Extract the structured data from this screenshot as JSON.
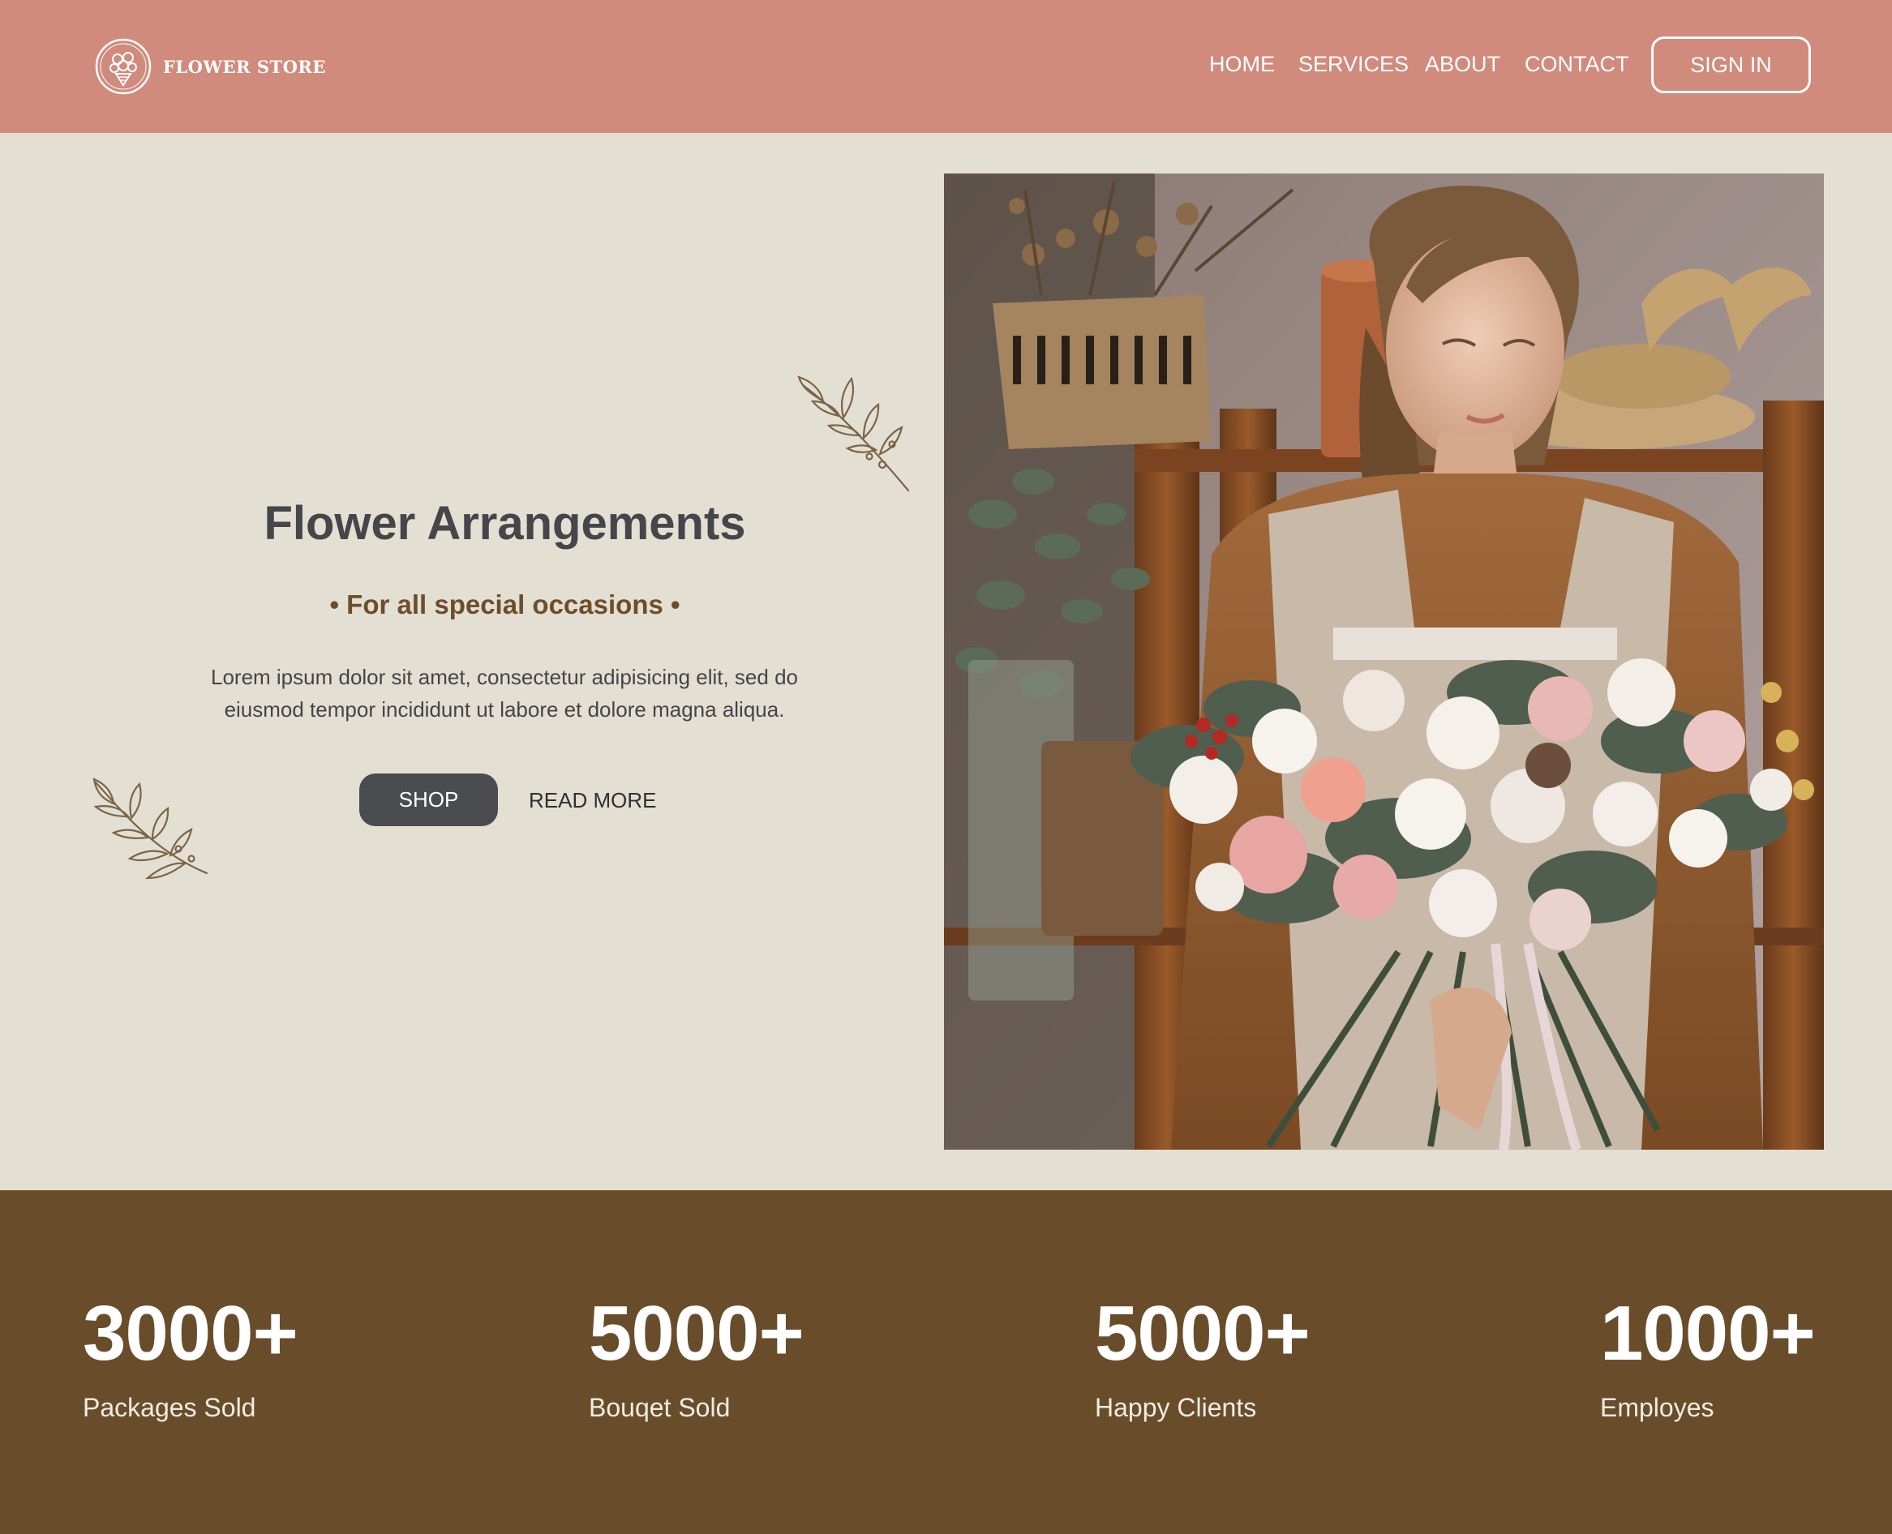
{
  "brand": {
    "name": "FLOWER STORE",
    "logo_icon": "bouquet-emblem-icon"
  },
  "nav": {
    "items": [
      {
        "label": "HOME"
      },
      {
        "label": "SERVICES"
      },
      {
        "label": "ABOUT"
      },
      {
        "label": "CONTACT"
      }
    ],
    "signin_label": "SIGN IN"
  },
  "hero": {
    "title": "Flower Arrangements",
    "subtitle": "• For all special occasions •",
    "description_line1": "Lorem ipsum dolor sit amet, consectetur adipisicing elit, sed do",
    "description_line2": "eiusmod tempor incididunt ut labore et dolore magna aliqua.",
    "shop_label": "SHOP",
    "read_more_label": "READ MORE",
    "decoration_icon": "olive-branch-icon"
  },
  "stats": [
    {
      "value": "3000+",
      "label": "Packages Sold"
    },
    {
      "value": "5000+",
      "label": "Bouqet Sold"
    },
    {
      "value": "5000+",
      "label": "Happy Clients"
    },
    {
      "value": "1000+",
      "label": "Employes"
    }
  ],
  "colors": {
    "header_bg": "#d08b7d",
    "page_bg": "#e4dfd3",
    "accent_brown": "#694d2b",
    "button_dark": "#4a4c4f",
    "title_text": "#45464a"
  }
}
